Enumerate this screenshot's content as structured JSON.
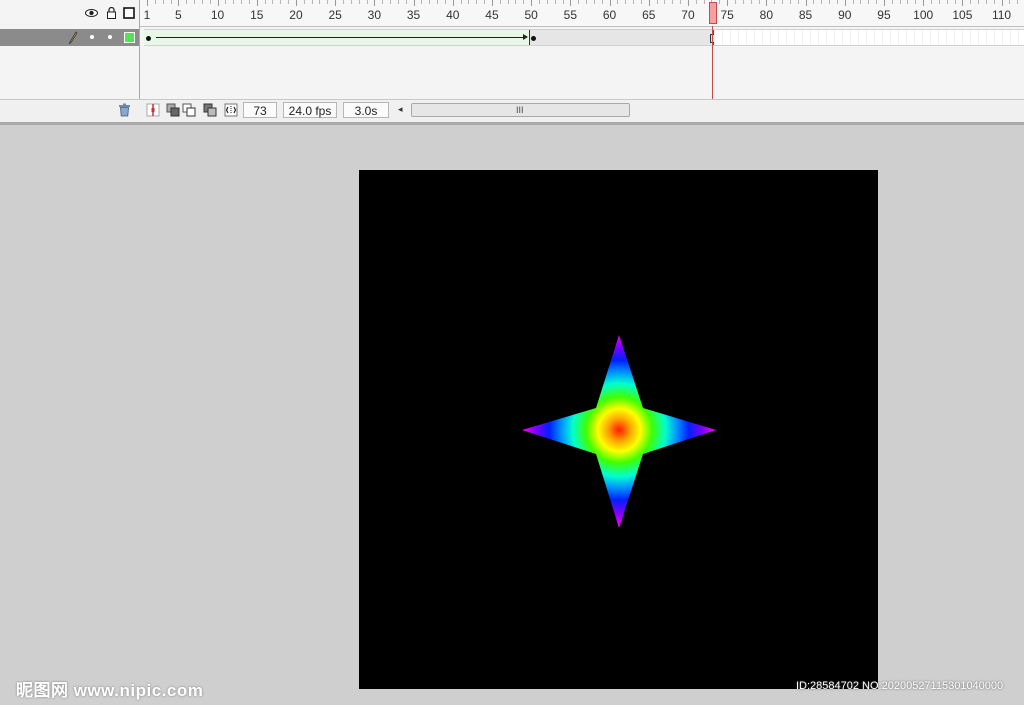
{
  "timeline": {
    "ruler_labels": [
      "1",
      "5",
      "10",
      "15",
      "20",
      "25",
      "30",
      "35",
      "40",
      "45",
      "50",
      "55",
      "60",
      "65",
      "70",
      "75",
      "80",
      "85",
      "90",
      "95",
      "100",
      "105",
      "110"
    ],
    "current_frame": "73",
    "fps": "24.0 fps",
    "elapsed_time": "3.0s",
    "scroll_grip": "III",
    "layer_color": "#55e055",
    "icons": [
      "eye-icon",
      "lock-icon",
      "outline-icon",
      "pencil-icon",
      "trash-icon"
    ]
  },
  "stage": {
    "background_color": "#000000",
    "shape": "four-point-star",
    "gradient_colors": [
      "#ff1a00",
      "#ffd000",
      "#40ff00",
      "#00e0ff",
      "#0020ff",
      "#ff00ff"
    ]
  },
  "watermark": {
    "left": "昵图网 www.nipic.com",
    "right": "ID:28584702 NO:20200527115301040000"
  }
}
